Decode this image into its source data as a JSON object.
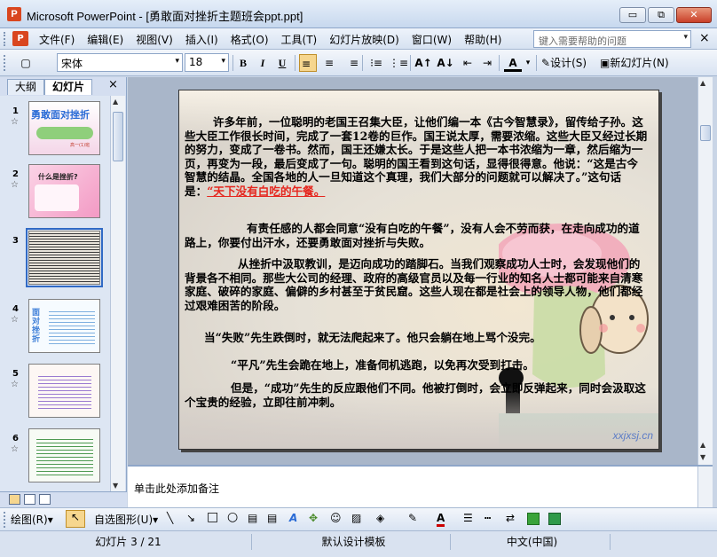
{
  "window": {
    "app_icon_glyph": "P",
    "title": "Microsoft PowerPoint - [勇敢面对挫折主题班会ppt.ppt]",
    "minimize_glyph": "▭",
    "restore_glyph": "⧉",
    "close_glyph": "✕"
  },
  "menu": {
    "doc_icon_glyph": "P",
    "items": [
      "文件(F)",
      "编辑(E)",
      "视图(V)",
      "插入(I)",
      "格式(O)",
      "工具(T)",
      "幻灯片放映(D)",
      "窗口(W)",
      "帮助(H)"
    ],
    "help_placeholder": "键入需要帮助的问题",
    "help_arrow": "▾",
    "close_glyph": "×"
  },
  "toolbar": {
    "new_glyph": "▢",
    "font_name": "宋体",
    "font_size": "18",
    "combo_arrow": "▾",
    "bold": "B",
    "italic": "I",
    "underline": "U",
    "align_left_glyph": "≡",
    "align_center_glyph": "≡",
    "align_right_glyph": "≡",
    "numbering_glyph": "⁝≡",
    "bullets_glyph": "⋮≡",
    "grow_font": "A↑",
    "shrink_font": "A↓",
    "indent_decrease_glyph": "⇤",
    "indent_increase_glyph": "⇥",
    "font_color_glyph": "A",
    "design_label": "设计(S)",
    "new_slide_label": "新幻灯片(N)"
  },
  "left_panel": {
    "tab_outline": "大纲",
    "tab_slides": "幻灯片",
    "close_glyph": "×",
    "star_glyph": "☆",
    "scroll_up": "▲",
    "scroll_down": "▼",
    "slides": [
      {
        "number": "1",
        "title": "勇敢面对挫折",
        "subtitle": "高一(1)班"
      },
      {
        "number": "2",
        "title": "什么是挫折?"
      },
      {
        "number": "3"
      },
      {
        "number": "4",
        "title": "面对挫折"
      },
      {
        "number": "5"
      },
      {
        "number": "6"
      }
    ]
  },
  "slide": {
    "para1": "许多年前，一位聪明的老国王召集大臣，让他们编一本《古今智慧录》，留传给子孙。这些大臣工作很长时间，完成了一套12卷的巨作。国王说太厚，需要浓缩。这些大臣又经过长期的努力，变成了一卷书。然而，国王还嫌太长。于是这些人把一本书浓缩为一章，然后缩为一页，再变为一段，最后变成了一句。聪明的国王看到这句话，显得很得意。他说：“这是古今智慧的结晶。全国各地的人一旦知道这个真理，我们大部分的问题就可以解决了。”这句话是：",
    "quote": "“天下没有白吃的午餐。",
    "para2": "有责任感的人都会同意“没有白吃的午餐”，没有人会不劳而获，在走向成功的道路上，你要付出汗水，还要勇敢面对挫折与失败。",
    "para3": "从挫折中汲取教训，是迈向成功的踏脚石。当我们观察成功人士时，会发现他们的背景各不相同。那些大公司的经理、政府的高级官员以及每一行业的知名人士都可能来自清寒家庭、破碎的家庭、偏僻的乡村甚至于贫民窟。这些人现在都是社会上的领导人物，他们都经过艰难困苦的阶段。",
    "para4": "当“失败”先生跌倒时，就无法爬起来了。他只会躺在地上骂个没完。",
    "para5": "“平凡”先生会跪在地上，准备伺机逃跑，以免再次受到打击。",
    "para6": "但是，“成功”先生的反应跟他们不同。他被打倒时，会立即反弹起来，同时会汲取这个宝贵的经验，立即往前冲刺。",
    "watermark": "xxjxsj.cn"
  },
  "notes": {
    "placeholder": "单击此处添加备注"
  },
  "drawing_toolbar": {
    "draw_label": "绘图(R)",
    "autoshapes_label": "自选图形(U)",
    "dropdown_glyph": "▾",
    "line_glyph": "╲",
    "arrow_glyph": "↘",
    "rect_glyph": "□",
    "oval_glyph": "○",
    "textbox_glyph": "▤",
    "wordart_glyph": "A",
    "font_color_glyph": "A",
    "cursor_glyph": "↖"
  },
  "status": {
    "slide_position": "幻灯片 3 / 21",
    "template": "默认设计模板",
    "language": "中文(中国)"
  },
  "colors": {
    "quote_red": "#e5271f",
    "title_close_red": "#c9402a",
    "selection_blue": "#316ac5"
  }
}
